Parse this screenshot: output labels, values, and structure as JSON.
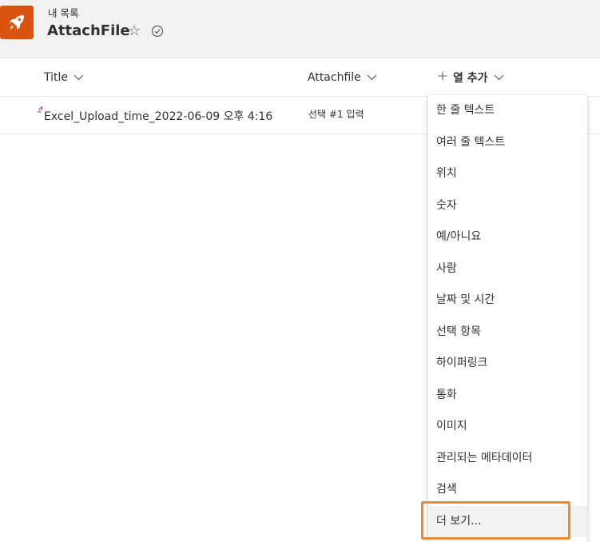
{
  "header": {
    "breadcrumb": "내 목록",
    "title": "AttachFile",
    "icons": [
      "rocket-icon",
      "star-icon",
      "following-check-icon"
    ]
  },
  "columns": [
    {
      "label": "Title",
      "icon": "chevron-down-icon"
    },
    {
      "label": "Attachfile",
      "icon": "chevron-down-icon"
    },
    {
      "label": "열 추가",
      "icon_left": "plus-icon",
      "icon": "chevron-down-icon"
    }
  ],
  "rows": [
    {
      "title": "Excel_Upload_time_2022-06-09 오후 4:16",
      "attachfile": "선택 #1 입력"
    }
  ],
  "menu": {
    "items": [
      "한 줄 텍스트",
      "여러 줄 텍스트",
      "위치",
      "숫자",
      "예/아니요",
      "사람",
      "날짜 및 시간",
      "선택 항목",
      "하이퍼링크",
      "통화",
      "이미지",
      "관리되는 메타데이터",
      "검색",
      "더 보기..."
    ]
  },
  "colors": {
    "logo": "#d9540e",
    "highlight": "#f28a30",
    "header_bg": "#f3f2f1",
    "new_badge": "#8e3a96"
  }
}
